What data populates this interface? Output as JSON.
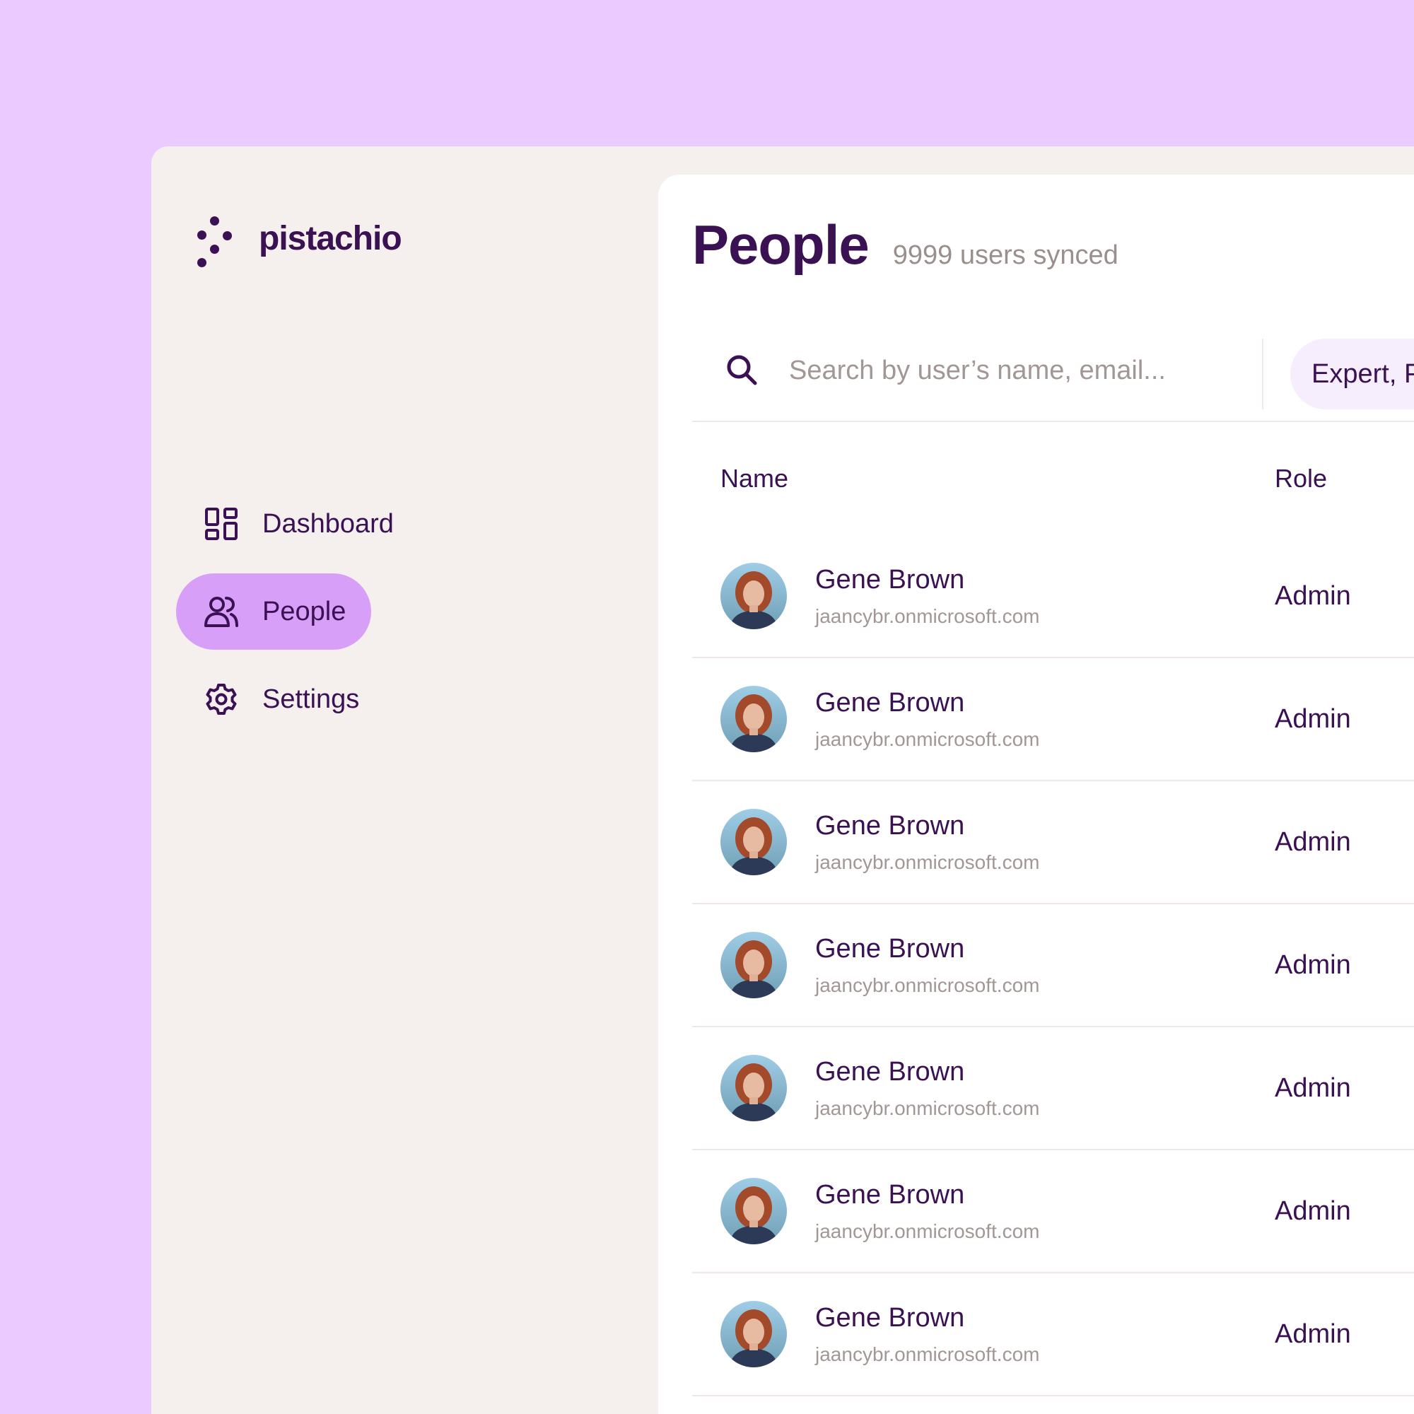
{
  "brand": {
    "name": "pistachio"
  },
  "sidebar": {
    "items": [
      {
        "label": "Dashboard",
        "icon": "dashboard-icon",
        "active": false
      },
      {
        "label": "People",
        "icon": "people-icon",
        "active": true
      },
      {
        "label": "Settings",
        "icon": "gear-icon",
        "active": false
      }
    ]
  },
  "page": {
    "title": "People",
    "subtitle": "9999 users synced"
  },
  "search": {
    "placeholder": "Search by user’s name, email...",
    "value": ""
  },
  "filter": {
    "label": "Expert, P"
  },
  "table": {
    "columns": [
      "Name",
      "Role"
    ],
    "rows": [
      {
        "name": "Gene Brown",
        "email": "jaancybr.onmicrosoft.com",
        "role": "Admin"
      },
      {
        "name": "Gene Brown",
        "email": "jaancybr.onmicrosoft.com",
        "role": "Admin"
      },
      {
        "name": "Gene Brown",
        "email": "jaancybr.onmicrosoft.com",
        "role": "Admin"
      },
      {
        "name": "Gene Brown",
        "email": "jaancybr.onmicrosoft.com",
        "role": "Admin"
      },
      {
        "name": "Gene Brown",
        "email": "jaancybr.onmicrosoft.com",
        "role": "Admin"
      },
      {
        "name": "Gene Brown",
        "email": "jaancybr.onmicrosoft.com",
        "role": "Admin"
      },
      {
        "name": "Gene Brown",
        "email": "jaancybr.onmicrosoft.com",
        "role": "Admin"
      }
    ]
  },
  "colors": {
    "background": "#ebcbff",
    "window": "#f5f0ee",
    "panel": "#ffffff",
    "primary_text": "#3a1152",
    "muted_text": "#a39796",
    "active_nav": "#d89ff9",
    "filter_chip": "#f7eefd"
  }
}
